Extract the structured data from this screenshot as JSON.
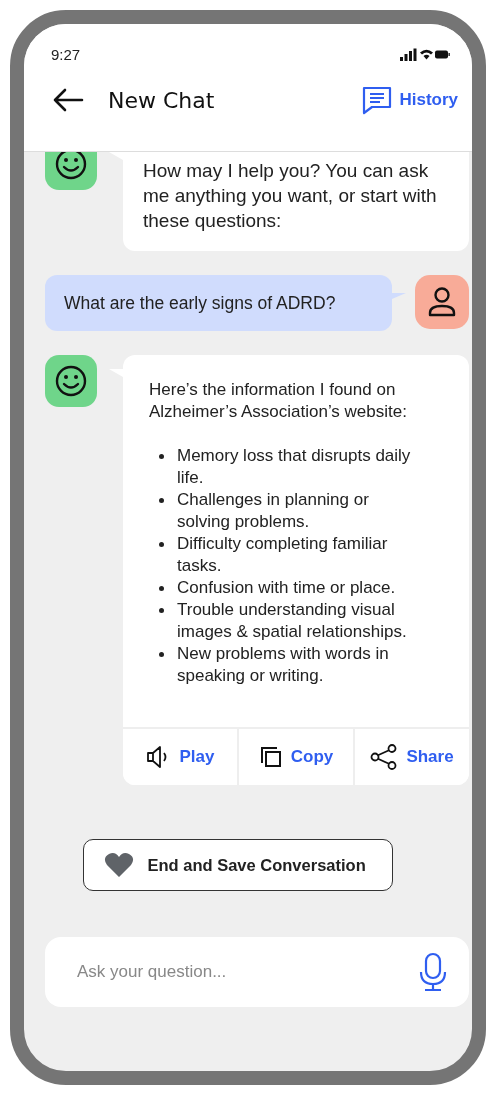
{
  "status_bar": {
    "time": "9:27"
  },
  "header": {
    "title": "New Chat",
    "history_label": "History"
  },
  "messages": [
    {
      "kind": "bot",
      "text": "How may I help you? You can ask me anything you want, or start with these questions:"
    },
    {
      "kind": "user",
      "text": "What are the early signs of ADRD?"
    },
    {
      "kind": "bot",
      "text": "Here’s the information I found on Alzheimer’s Association’s website:",
      "bullets": [
        "Memory loss that disrupts daily life.",
        "Challenges in planning or solving problems.",
        "Difficulty completing familiar tasks.",
        "Confusion with time or place.",
        "Trouble understanding visual images & spatial relationships.",
        "New problems with words in speaking or writing."
      ],
      "actions": [
        {
          "kind": "play",
          "label": "Play"
        },
        {
          "kind": "copy",
          "label": "Copy"
        },
        {
          "kind": "share",
          "label": "Share"
        }
      ]
    }
  ],
  "end_button": {
    "label": "End and Save Conversation"
  },
  "input": {
    "placeholder": "Ask your question..."
  }
}
